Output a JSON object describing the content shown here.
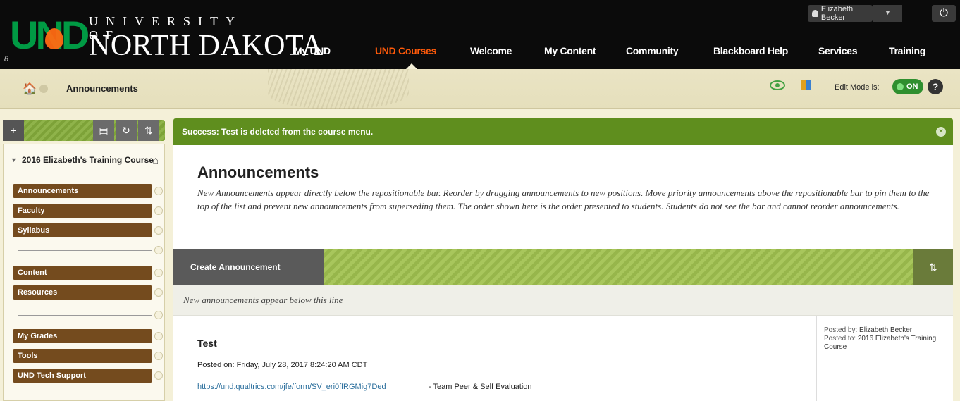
{
  "header": {
    "logo_und": "UND",
    "logo_university_of": "UNIVERSITY OF",
    "logo_north_dakota": "NORTH DAKOTA",
    "logo_mark": "8",
    "nav": [
      {
        "label": "My UND"
      },
      {
        "label": "UND Courses",
        "active": true
      },
      {
        "label": "Welcome"
      },
      {
        "label": "My Content"
      },
      {
        "label": "Community"
      },
      {
        "label": "Blackboard Help"
      },
      {
        "label": "Services"
      },
      {
        "label": "Training"
      }
    ],
    "user_name": "Elizabeth Becker",
    "user_dropdown": "▼",
    "power_icon": "⏻"
  },
  "breadcrumb": {
    "home_icon": "🏠",
    "title": "Announcements",
    "edit_mode_label": "Edit Mode is:",
    "edit_mode_state": "ON",
    "help": "?"
  },
  "course_menu": {
    "toolbar": {
      "add": "+",
      "folder": "▤",
      "refresh": "↻",
      "sort": "⇅"
    },
    "course_title": "2016 Elizabeth's Training Course",
    "home_icon": "⌂",
    "items_group1": [
      "Announcements",
      "Faculty",
      "Syllabus"
    ],
    "items_group2": [
      "Content",
      "Resources"
    ],
    "items_group3": [
      "My Grades",
      "Tools",
      "UND Tech Support"
    ]
  },
  "main": {
    "success_message": "Success: Test is deleted from the course menu.",
    "close_icon": "×",
    "page_title": "Announcements",
    "page_description": "New Announcements appear directly below the repositionable bar. Reorder by dragging announcements to new positions. Move priority announcements above the repositionable bar to pin them to the top of the list and prevent new announcements from superseding them. The order shown here is the order presented to students. Students do not see the bar and cannot reorder announcements.",
    "create_button": "Create Announcement",
    "sort_icon": "⇅",
    "new_line_text": "New announcements appear below this line",
    "announcement": {
      "title": "Test",
      "posted_on": "Posted on: Friday, July 28, 2017 8:24:20 AM CDT",
      "link": "https://und.qualtrics.com/jfe/form/SV_eri0ffRGMig7Ded",
      "link_desc": "- Team Peer & Self Evaluation",
      "posted_by_label": "Posted by:",
      "posted_by": "Elizabeth Becker",
      "posted_to_label": "Posted to:",
      "posted_to": "2016 Elizabeth's Training Course"
    }
  },
  "colors": {
    "accent_orange": "#ff5a0a",
    "brand_green": "#009a44",
    "menu_brown": "#744b1e",
    "success_green": "#5f8e1e"
  }
}
